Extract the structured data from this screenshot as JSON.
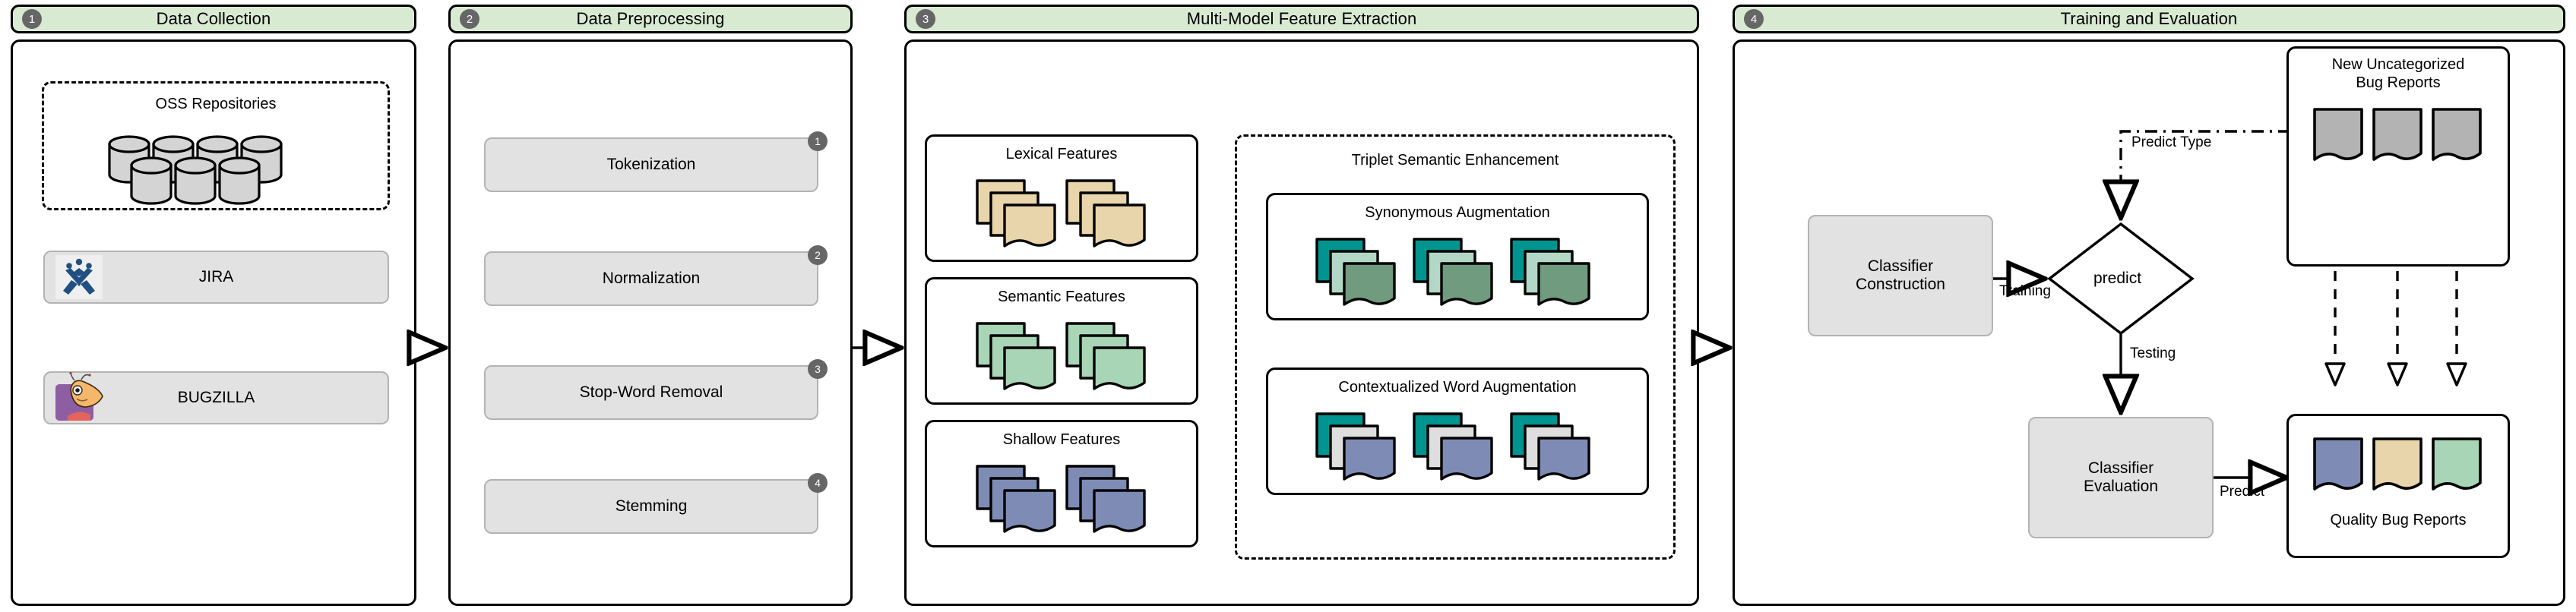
{
  "diagram": {
    "title": "Bug report classification pipeline",
    "colors": {
      "stage_header_bg": "#d9ead3",
      "badge": "#666666",
      "grey_box": "#e2e2e2",
      "lexical_doc": "#e8d5ab",
      "semantic_doc": "#a8d5b5",
      "shallow_doc": "#7e8cb5",
      "teal_doc": "#009490",
      "mint_doc": "#b3d7c6",
      "sage_doc": "#709b7e",
      "light_grey_doc": "#dedede",
      "uncategorized_doc": "#b3b3b3"
    }
  },
  "stages": [
    {
      "number": "1",
      "title": "Data Collection"
    },
    {
      "number": "2",
      "title": "Data Preprocessing"
    },
    {
      "number": "3",
      "title": "Multi-Model Feature Extraction"
    },
    {
      "number": "4",
      "title": "Training and Evaluation"
    }
  ],
  "stage1": {
    "repositories_caption": "OSS Repositories",
    "sources": [
      {
        "label": "JIRA",
        "icon": "jira-icon"
      },
      {
        "label": "BUGZILLA",
        "icon": "bugzilla-icon"
      }
    ]
  },
  "stage2": {
    "steps": [
      {
        "number": "1",
        "label": "Tokenization"
      },
      {
        "number": "2",
        "label": "Normalization"
      },
      {
        "number": "3",
        "label": "Stop-Word Removal"
      },
      {
        "number": "4",
        "label": "Stemming"
      }
    ]
  },
  "stage3": {
    "features": [
      {
        "label": "Lexical Features"
      },
      {
        "label": "Semantic Features"
      },
      {
        "label": "Shallow Features"
      }
    ],
    "enhancement": {
      "caption": "Triplet Semantic Enhancement",
      "blocks": [
        {
          "label": "Synonymous Augmentation"
        },
        {
          "label": "Contextualized Word Augmentation"
        }
      ]
    }
  },
  "stage4": {
    "classifier_construction": "Classifier\nConstruction",
    "classifier_construction_line1": "Classifier",
    "classifier_construction_line2": "Construction",
    "classifier_evaluation_line1": "Classifier",
    "classifier_evaluation_line2": "Evaluation",
    "decision": "predict",
    "edges": {
      "training": "Training",
      "testing": "Testing",
      "predict": "Predict",
      "predict_type": "Predict Type"
    },
    "new_reports_line1": "New Uncategorized",
    "new_reports_line2": "Bug Reports",
    "quality_reports": "Quality  Bug Reports"
  }
}
